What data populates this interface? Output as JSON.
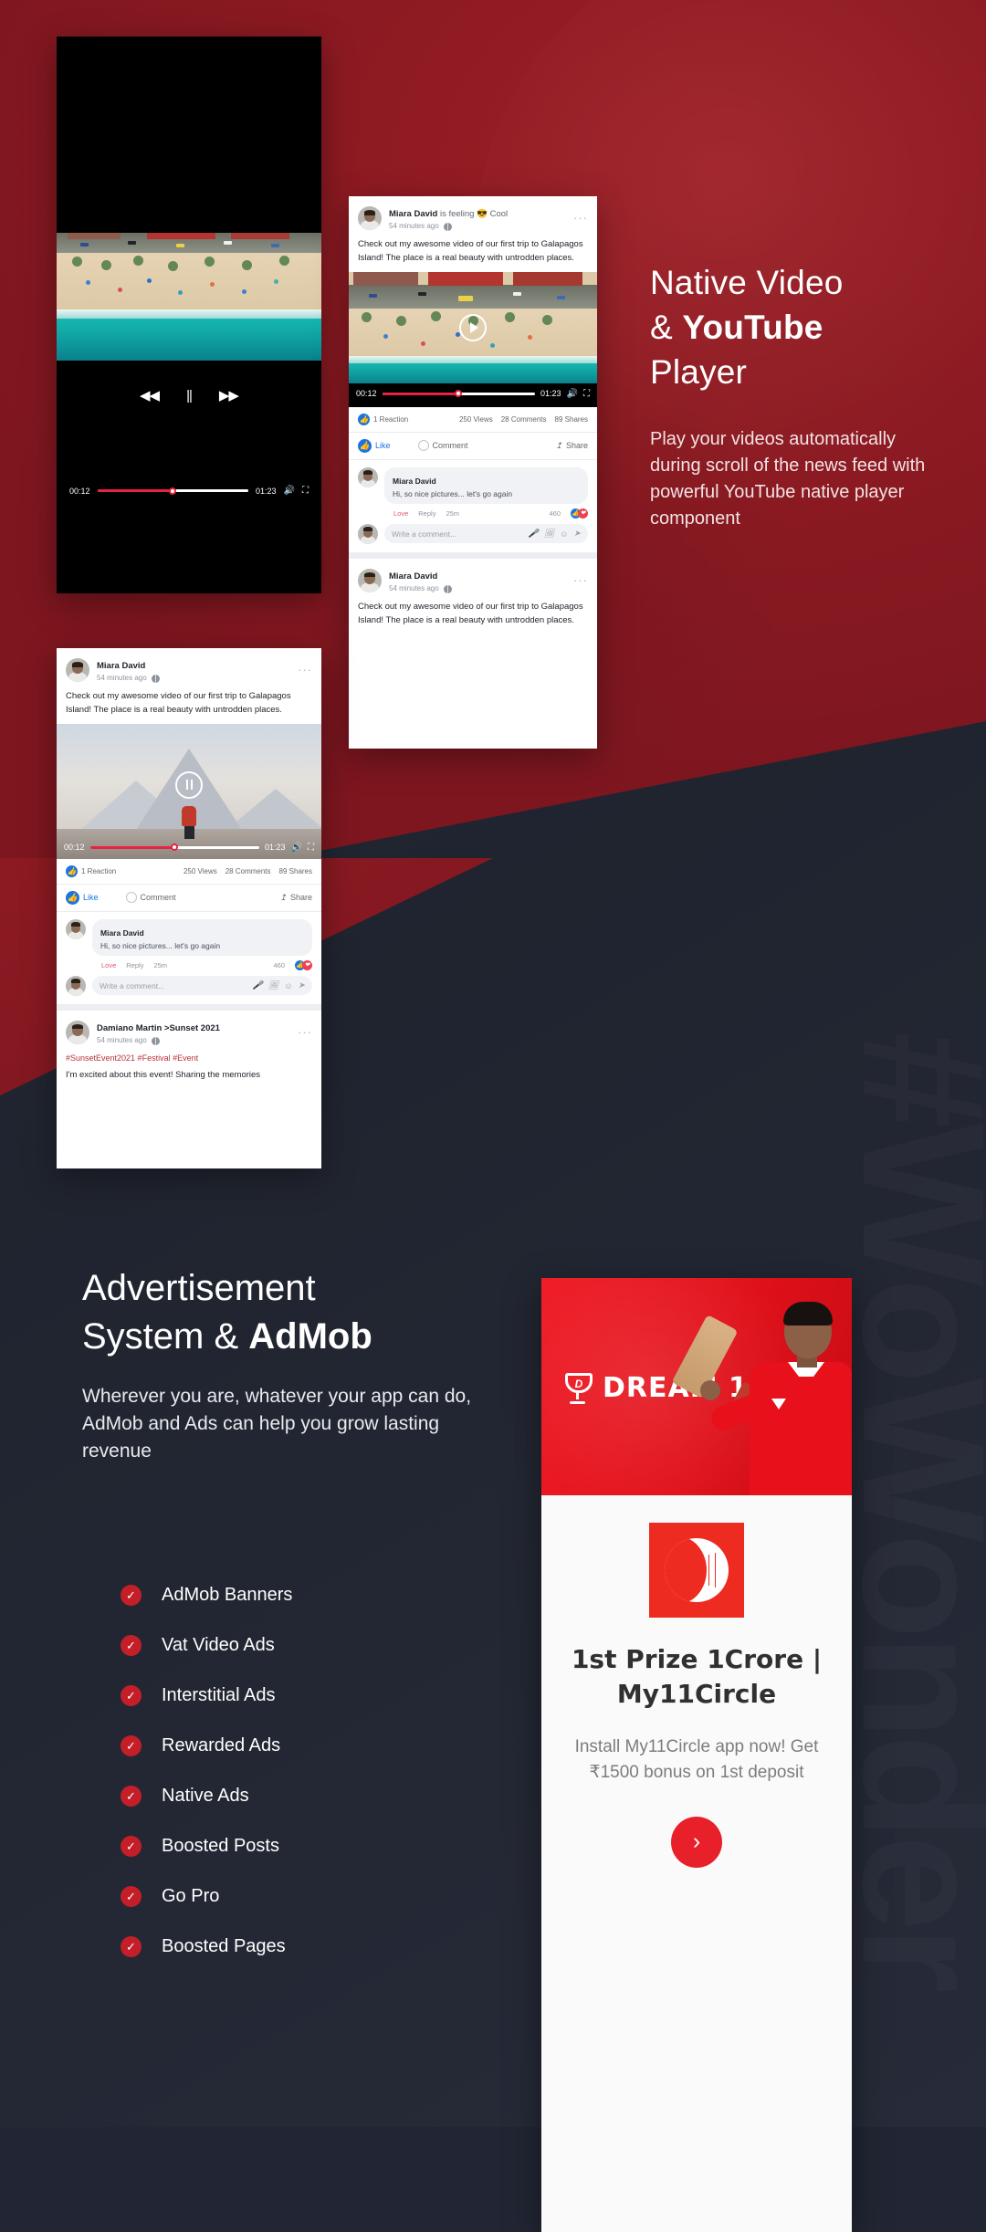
{
  "sections": {
    "video": {
      "heading_line1": "Native Video",
      "heading_line2_plain": "& ",
      "heading_line2_bold": "YouTube",
      "heading_line3": "Player",
      "paragraph": "Play your  videos automatically during scroll of the news feed with powerful YouTube native player component"
    },
    "ads": {
      "heading_line1": "Advertisement",
      "heading_line2_plain": "System & ",
      "heading_line2_bold": "AdMob",
      "paragraph": "Wherever you are, whatever your app can do, AdMob and Ads can help you grow lasting revenue",
      "features": [
        "AdMob Banners",
        "Vat Video Ads",
        "Interstitial Ads",
        "Rewarded Ads",
        "Native Ads",
        "Boosted Posts",
        "Go Pro",
        "Boosted Pages"
      ],
      "check_glyph": "✓"
    }
  },
  "watermark": "#WoWonder",
  "player": {
    "current_time": "00:12",
    "duration": "01:23",
    "rewind_glyph": "◀◀",
    "pause_glyph": "||",
    "forward_glyph": "▶▶",
    "volume_glyph": "🔊",
    "fullscreen_glyph": "⛶",
    "progress_percent": 50
  },
  "post": {
    "author": "Miara David",
    "feeling_prefix": "is feeling",
    "feeling_emoji": "😎",
    "feeling": "Cool",
    "timestamp": "54 minutes ago",
    "privacy_icon": "globe-icon",
    "more_glyph": "···",
    "body": "Check out my awesome video of our first trip to Galapagos Island! The place is a real beauty with untrodden places.",
    "stats": {
      "reactions": "1 Reaction",
      "views": "250 Views",
      "comments": "28 Comments",
      "shares": "89 Shares"
    },
    "actions": {
      "like": "Like",
      "comment": "Comment",
      "share": "Share"
    },
    "comment": {
      "author": "Miara David",
      "text": "Hi, so nice pictures... let's go again",
      "love": "Love",
      "reply": "Reply",
      "time": "25m",
      "count": "460"
    },
    "composer": {
      "placeholder": "Write a comment...",
      "mic_glyph": "🎤",
      "image_glyph": "🖼",
      "emoji_glyph": "☺",
      "send_glyph": "➤"
    }
  },
  "post2": {
    "author": "Damiano Martin",
    "page_separator": ">",
    "page": "Sunset 2021",
    "timestamp": "54 minutes ago",
    "hashtags": "#SunsetEvent2021 #Festival #Event",
    "body": "I'm excited about this event! Sharing the memories"
  },
  "ad_card": {
    "brand": "DREAM 11",
    "brand_logo": "dream11-trophy-icon",
    "app_logo": "my11circle-logo",
    "title": "1st Prize 1Crore | My11Circle",
    "description": "Install My11Circle app now! Get ₹1500 bonus on 1st deposit",
    "cta_glyph": "›"
  },
  "colors": {
    "red": "#8d1a22",
    "dark": "#262a38",
    "accent": "#c41f28",
    "ad_red": "#e8101a",
    "fb_blue": "#1b74e4"
  }
}
